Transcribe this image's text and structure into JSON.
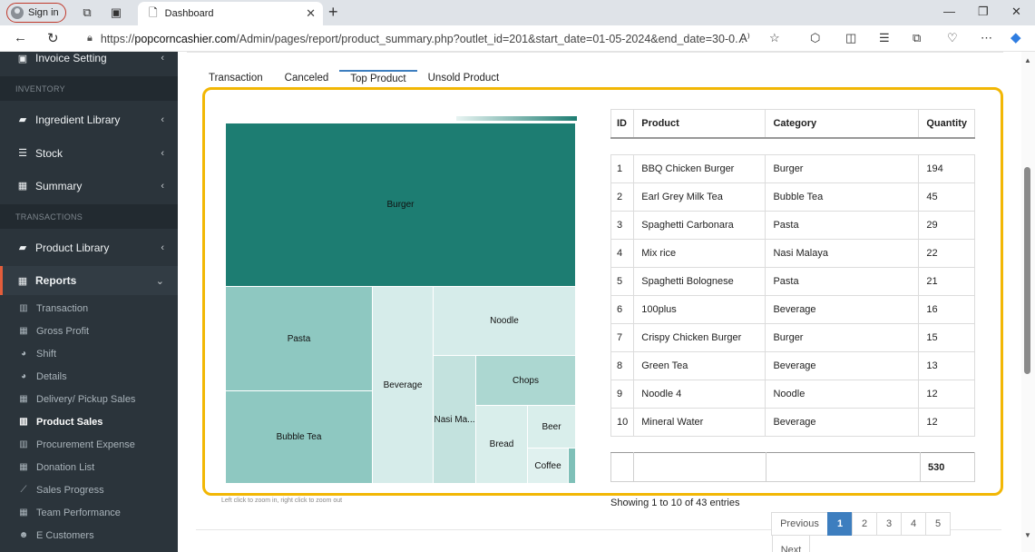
{
  "browser": {
    "signin_label": "Sign in",
    "tab_title": "Dashboard",
    "url_prefix": "https://",
    "url_host": "popcorncashier.com",
    "url_path": "/Admin/pages/report/product_summary.php?outlet_id=201&start_date=01-05-2024&end_date=30-0...",
    "read_aloud_label": "A⁾"
  },
  "sidebar": {
    "top_item": "Invoice Setting",
    "section_inventory": "INVENTORY",
    "inventory_items": [
      {
        "label": "Ingredient Library"
      },
      {
        "label": "Stock"
      },
      {
        "label": "Summary"
      }
    ],
    "section_transactions": "TRANSACTIONS",
    "product_library": "Product Library",
    "reports": "Reports",
    "report_items": [
      {
        "label": "Transaction"
      },
      {
        "label": "Gross Profit"
      },
      {
        "label": "Shift"
      },
      {
        "label": "Details"
      },
      {
        "label": "Delivery/ Pickup Sales"
      },
      {
        "label": "Product Sales"
      },
      {
        "label": "Procurement Expense"
      },
      {
        "label": "Donation List"
      },
      {
        "label": "Sales Progress"
      },
      {
        "label": "Team Performance"
      },
      {
        "label": "E Customers"
      }
    ]
  },
  "tabs": [
    {
      "label": "Transaction"
    },
    {
      "label": "Canceled"
    },
    {
      "label": "Top Product"
    },
    {
      "label": "Unsold Product"
    }
  ],
  "treemap": {
    "hint": "Left click to zoom in, right click to zoom out",
    "cells": [
      {
        "label": "Burger",
        "color": "#1d7d72"
      },
      {
        "label": "Pasta",
        "color": "#8ec8c1"
      },
      {
        "label": "Bubble Tea",
        "color": "#8ec8c1"
      },
      {
        "label": "Beverage",
        "color": "#d6ecea"
      },
      {
        "label": "Noodle",
        "color": "#d6ecea"
      },
      {
        "label": "Nasi Ma...",
        "color": "#c3e2de"
      },
      {
        "label": "Chops",
        "color": "#acd7d1"
      },
      {
        "label": "Bread",
        "color": "#d9eeeb"
      },
      {
        "label": "Beer",
        "color": "#d9eeeb"
      },
      {
        "label": "Coffee",
        "color": "#e0f1ef"
      },
      {
        "label": "",
        "color": "#7fc0b8"
      }
    ]
  },
  "table": {
    "headers": [
      "ID",
      "Product",
      "Category",
      "Quantity"
    ],
    "rows": [
      {
        "id": "1",
        "product": "BBQ Chicken Burger",
        "category": "Burger",
        "qty": "194"
      },
      {
        "id": "2",
        "product": "Earl Grey Milk Tea",
        "category": "Bubble Tea",
        "qty": "45"
      },
      {
        "id": "3",
        "product": "Spaghetti Carbonara",
        "category": "Pasta",
        "qty": "29"
      },
      {
        "id": "4",
        "product": "Mix rice",
        "category": "Nasi Malaya",
        "qty": "22"
      },
      {
        "id": "5",
        "product": "Spaghetti Bolognese",
        "category": "Pasta",
        "qty": "21"
      },
      {
        "id": "6",
        "product": "100plus",
        "category": "Beverage",
        "qty": "16"
      },
      {
        "id": "7",
        "product": "Crispy Chicken Burger",
        "category": "Burger",
        "qty": "15"
      },
      {
        "id": "8",
        "product": "Green Tea",
        "category": "Beverage",
        "qty": "13"
      },
      {
        "id": "9",
        "product": "Noodle 4",
        "category": "Noodle",
        "qty": "12"
      },
      {
        "id": "10",
        "product": "Mineral Water",
        "category": "Beverage",
        "qty": "12"
      }
    ],
    "total": "530"
  },
  "pagination": {
    "showing": "Showing 1 to 10 of 43 entries",
    "previous": "Previous",
    "pages": [
      "1",
      "2",
      "3",
      "4",
      "5"
    ],
    "next": "Next"
  },
  "colors": {
    "accent": "#3d7ebf",
    "highlight_border": "#f2b705",
    "sidebar_bg": "#2b343b",
    "active_marker": "#e35d3b"
  }
}
